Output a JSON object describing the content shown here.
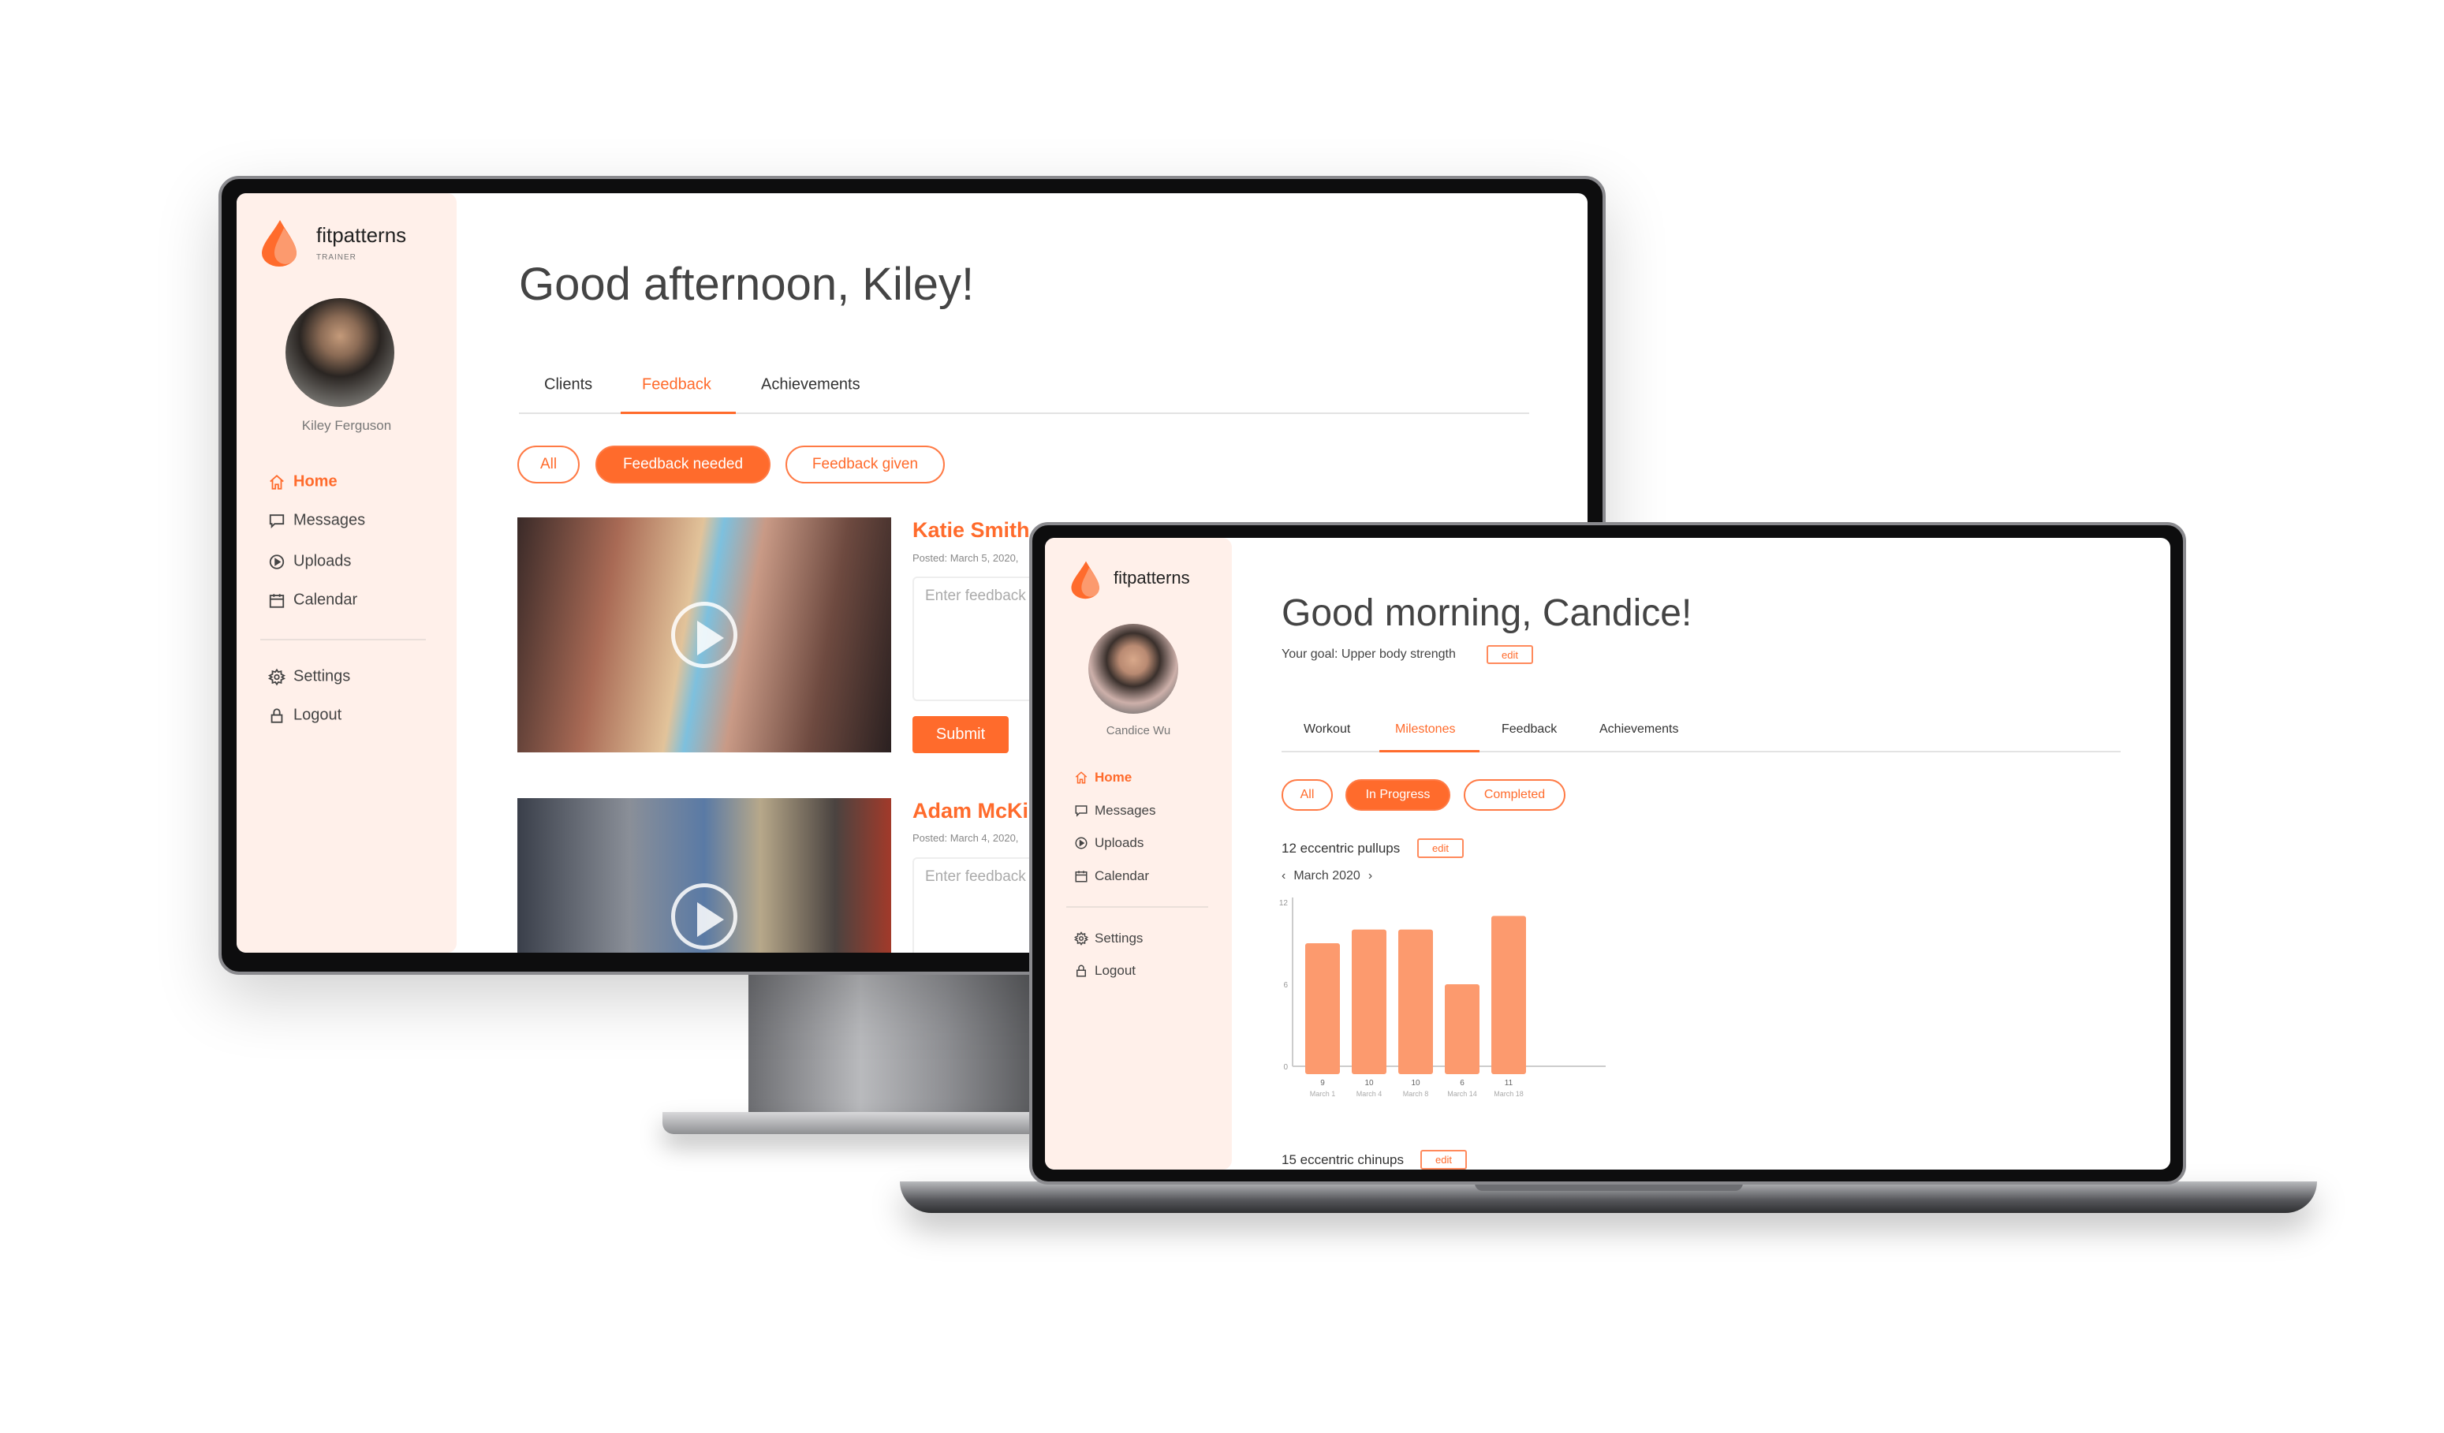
{
  "colors": {
    "accent": "#ff6b2c",
    "sidebar_bg": "#fff0ea",
    "bar": "#fc9a6e"
  },
  "monitor": {
    "brand": "fitpatterns",
    "brand_sub": "TRAINER",
    "user_name": "Kiley Ferguson",
    "nav": [
      {
        "label": "Home",
        "icon": "home-icon",
        "active": true
      },
      {
        "label": "Messages",
        "icon": "message-icon"
      },
      {
        "label": "Uploads",
        "icon": "play-circle-icon"
      },
      {
        "label": "Calendar",
        "icon": "calendar-icon"
      },
      {
        "label": "Settings",
        "icon": "gear-icon"
      },
      {
        "label": "Logout",
        "icon": "lock-icon"
      }
    ],
    "greeting": "Good afternoon, Kiley!",
    "tabs": [
      {
        "label": "Clients"
      },
      {
        "label": "Feedback",
        "active": true
      },
      {
        "label": "Achievements"
      }
    ],
    "filters": [
      {
        "label": "All"
      },
      {
        "label": "Feedback needed",
        "active": true
      },
      {
        "label": "Feedback given"
      }
    ],
    "posts": [
      {
        "name": "Katie Smith",
        "posted": "Posted: March 5, 2020,",
        "placeholder": "Enter feedback",
        "submit": "Submit"
      },
      {
        "name": "Adam McKin",
        "posted": "Posted: March 4, 2020,",
        "placeholder": "Enter feedback"
      }
    ]
  },
  "laptop": {
    "brand": "fitpatterns",
    "user_name": "Candice Wu",
    "nav": [
      {
        "label": "Home",
        "icon": "home-icon",
        "active": true
      },
      {
        "label": "Messages",
        "icon": "message-icon"
      },
      {
        "label": "Uploads",
        "icon": "play-circle-icon"
      },
      {
        "label": "Calendar",
        "icon": "calendar-icon"
      },
      {
        "label": "Settings",
        "icon": "gear-icon"
      },
      {
        "label": "Logout",
        "icon": "lock-icon"
      }
    ],
    "greeting": "Good morning, Candice!",
    "goal": "Your goal: Upper body strength",
    "edit": "edit",
    "tabs": [
      {
        "label": "Workout"
      },
      {
        "label": "Milestones",
        "active": true
      },
      {
        "label": "Feedback"
      },
      {
        "label": "Achievements"
      }
    ],
    "filters": [
      {
        "label": "All"
      },
      {
        "label": "In Progress",
        "active": true
      },
      {
        "label": "Completed"
      }
    ],
    "milestones": [
      {
        "title": "12 eccentric pullups",
        "month": "March 2020"
      },
      {
        "title": "15 eccentric chinups"
      }
    ]
  },
  "chart_data": {
    "type": "bar",
    "categories": [
      "March 1",
      "March 4",
      "March 8",
      "March 14",
      "March 18"
    ],
    "values": [
      9,
      10,
      10,
      6,
      11
    ],
    "yticks": [
      "12",
      "6",
      "0"
    ],
    "ylim": [
      0,
      12
    ],
    "grid": false
  }
}
